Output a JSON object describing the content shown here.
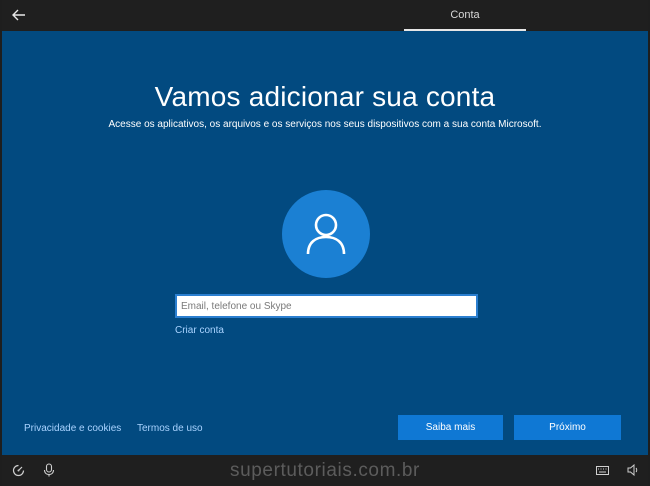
{
  "header": {
    "tab_label": "Conta"
  },
  "main": {
    "title": "Vamos adicionar sua conta",
    "subtitle": "Acesse os aplicativos, os arquivos e os serviços nos seus dispositivos com a sua conta Microsoft.",
    "account_input": {
      "value": "",
      "placeholder": "Email, telefone ou Skype"
    },
    "create_account_link": "Criar conta"
  },
  "footer": {
    "privacy_link": "Privacidade e cookies",
    "terms_link": "Termos de uso",
    "learn_more_button": "Saiba mais",
    "next_button": "Próximo"
  },
  "taskbar": {
    "watermark": "supertutoriais.com.br",
    "icons": [
      "ease-of-access-icon",
      "microphone-icon",
      "keyboard-icon",
      "volume-icon"
    ]
  },
  "colors": {
    "background": "#024a80",
    "accent": "#0f78d4",
    "link": "#a9d3ff",
    "avatar": "#1b80d3"
  }
}
